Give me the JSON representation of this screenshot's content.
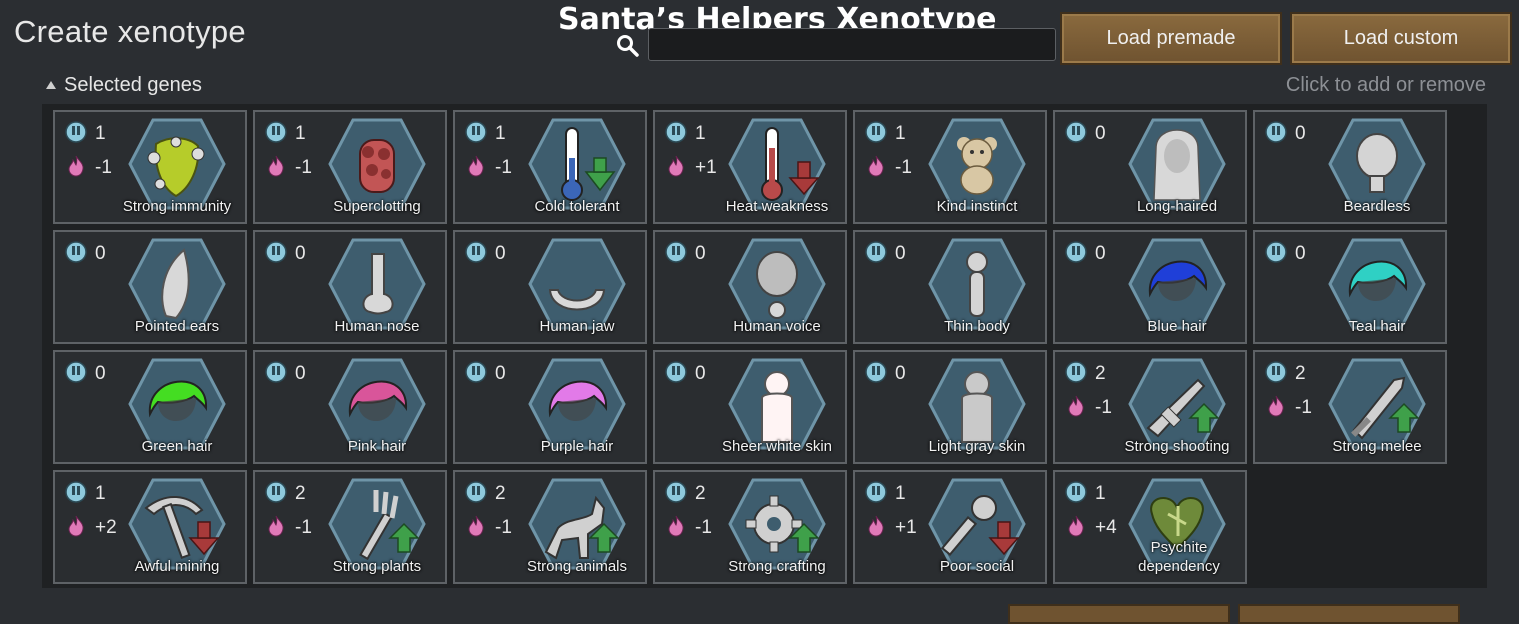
{
  "header": {
    "title": "Create xenotype",
    "xenotype_name": "Santa’s Helpers Xenotype",
    "search_value": "",
    "load_premade_label": "Load premade",
    "load_custom_label": "Load custom"
  },
  "section": {
    "label": "Selected genes",
    "hint": "Click to add or remove"
  },
  "colors": {
    "complexity_icon": "#8ec9dc",
    "metabolism_icon": "#e07ab8",
    "hex_fill": "#3e5d6e",
    "hex_border": "#6f95a8",
    "button_wood": "#7a5c35"
  },
  "genes": [
    {
      "name": "Strong immunity",
      "complexity": "1",
      "metabolism": "-1",
      "icon": "immunity-icon"
    },
    {
      "name": "Superclotting",
      "complexity": "1",
      "metabolism": "-1",
      "icon": "clotting-icon"
    },
    {
      "name": "Cold tolerant",
      "complexity": "1",
      "metabolism": "-1",
      "icon": "thermometer-cold-icon"
    },
    {
      "name": "Heat weakness",
      "complexity": "1",
      "metabolism": "+1",
      "icon": "thermometer-heat-icon"
    },
    {
      "name": "Kind instinct",
      "complexity": "1",
      "metabolism": "-1",
      "icon": "teddy-bear-icon"
    },
    {
      "name": "Long-haired",
      "complexity": "0",
      "metabolism": "",
      "icon": "long-hair-icon"
    },
    {
      "name": "Beardless",
      "complexity": "0",
      "metabolism": "",
      "icon": "beardless-head-icon"
    },
    {
      "name": "Pointed ears",
      "complexity": "0",
      "metabolism": "",
      "icon": "pointed-ear-icon"
    },
    {
      "name": "Human nose",
      "complexity": "0",
      "metabolism": "",
      "icon": "nose-icon"
    },
    {
      "name": "Human jaw",
      "complexity": "0",
      "metabolism": "",
      "icon": "jaw-icon"
    },
    {
      "name": "Human voice",
      "complexity": "0",
      "metabolism": "",
      "icon": "voice-head-icon"
    },
    {
      "name": "Thin body",
      "complexity": "0",
      "metabolism": "",
      "icon": "thin-body-icon"
    },
    {
      "name": "Blue hair",
      "complexity": "0",
      "metabolism": "",
      "icon": "hair-blue-icon",
      "color": "#1f3fd8"
    },
    {
      "name": "Teal hair",
      "complexity": "0",
      "metabolism": "",
      "icon": "hair-teal-icon",
      "color": "#2fd0c4"
    },
    {
      "name": "Green hair",
      "complexity": "0",
      "metabolism": "",
      "icon": "hair-green-icon",
      "color": "#44dd22"
    },
    {
      "name": "Pink hair",
      "complexity": "0",
      "metabolism": "",
      "icon": "hair-pink-icon",
      "color": "#d9559a"
    },
    {
      "name": "Purple hair",
      "complexity": "0",
      "metabolism": "",
      "icon": "hair-purple-icon",
      "color": "#e27ae8"
    },
    {
      "name": "Sheer white skin",
      "complexity": "0",
      "metabolism": "",
      "icon": "skin-white-icon",
      "color": "#fff4f4"
    },
    {
      "name": "Light gray skin",
      "complexity": "0",
      "metabolism": "",
      "icon": "skin-gray-icon",
      "color": "#c9c9c9"
    },
    {
      "name": "Strong shooting",
      "complexity": "2",
      "metabolism": "-1",
      "icon": "rifle-up-icon"
    },
    {
      "name": "Strong melee",
      "complexity": "2",
      "metabolism": "-1",
      "icon": "sword-up-icon"
    },
    {
      "name": "Awful mining",
      "complexity": "1",
      "metabolism": "+2",
      "icon": "pickaxe-down-icon"
    },
    {
      "name": "Strong plants",
      "complexity": "2",
      "metabolism": "-1",
      "icon": "fork-up-icon"
    },
    {
      "name": "Strong animals",
      "complexity": "2",
      "metabolism": "-1",
      "icon": "animal-up-icon"
    },
    {
      "name": "Strong crafting",
      "complexity": "2",
      "metabolism": "-1",
      "icon": "gear-up-icon"
    },
    {
      "name": "Poor social",
      "complexity": "1",
      "metabolism": "+1",
      "icon": "microphone-down-icon"
    },
    {
      "name": "Psychite dependency",
      "complexity": "1",
      "metabolism": "+4",
      "icon": "psychite-leaf-icon"
    }
  ]
}
